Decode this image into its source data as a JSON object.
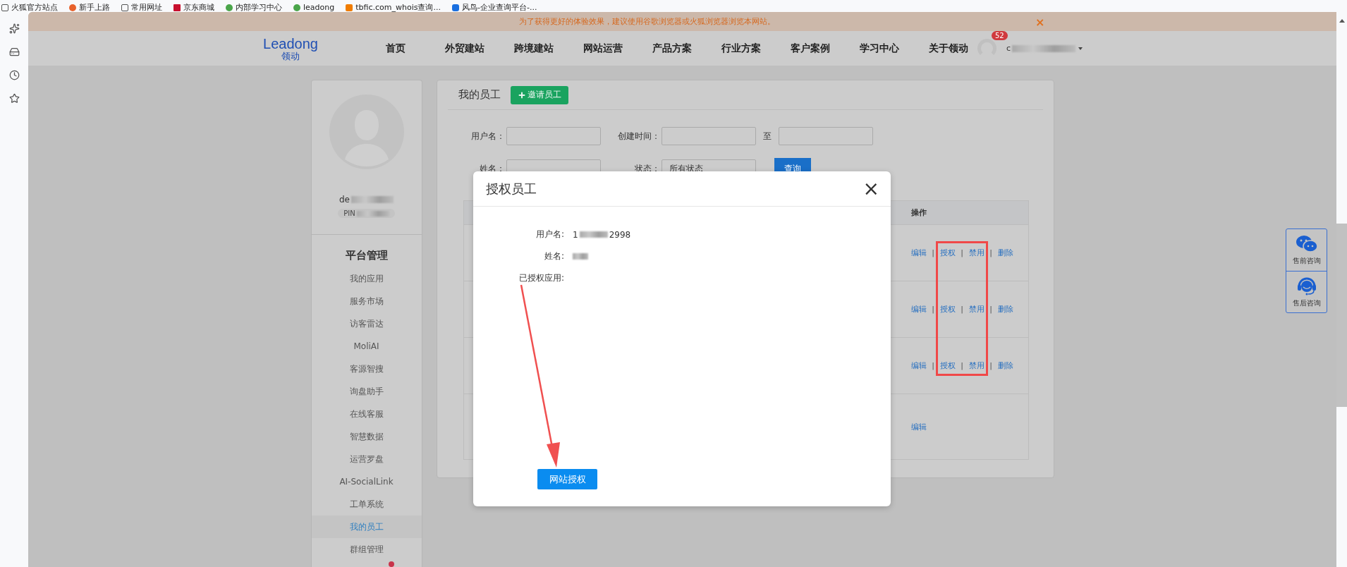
{
  "bookmarks": [
    {
      "label": "火狐官方站点"
    },
    {
      "label": "新手上路"
    },
    {
      "label": "常用网址"
    },
    {
      "label": "京东商城"
    },
    {
      "label": "内部学习中心"
    },
    {
      "label": "leadong"
    },
    {
      "label": "tbfic.com_whois查询..."
    },
    {
      "label": "风鸟-企业查询平台-..."
    }
  ],
  "notice": {
    "text": "为了获得更好的体验效果，建议使用谷歌浏览器或火狐浏览器浏览本网站。",
    "close": "×"
  },
  "nav": {
    "logo": {
      "name": "Leadong",
      "subtitle": "领动"
    },
    "items": [
      {
        "label": "首页"
      },
      {
        "label": "外贸建站"
      },
      {
        "label": "跨境建站"
      },
      {
        "label": "网站运营"
      },
      {
        "label": "产品方案"
      },
      {
        "label": "行业方案"
      },
      {
        "label": "客户案例"
      },
      {
        "label": "学习中心"
      },
      {
        "label": "关于领动"
      }
    ],
    "user": {
      "badge": "52",
      "name": "c"
    }
  },
  "profile": {
    "name": "de",
    "tag": "PIN"
  },
  "sidebar": {
    "title": "平台管理",
    "items": [
      {
        "label": "我的应用",
        "selected": false
      },
      {
        "label": "服务市场",
        "selected": false
      },
      {
        "label": "访客雷达",
        "selected": false
      },
      {
        "label": "MoliAI",
        "selected": false
      },
      {
        "label": "客源智搜",
        "selected": false
      },
      {
        "label": "询盘助手",
        "selected": false
      },
      {
        "label": "在线客服",
        "selected": false
      },
      {
        "label": "智慧数据",
        "selected": false
      },
      {
        "label": "运营罗盘",
        "selected": false
      },
      {
        "label": "AI-SocialLink",
        "selected": false
      },
      {
        "label": "工单系统",
        "selected": false
      },
      {
        "label": "我的员工",
        "selected": true
      },
      {
        "label": "群组管理",
        "selected": false
      }
    ]
  },
  "panel": {
    "title": "我的员工",
    "invite_button": "邀请员工",
    "filters": {
      "username": "用户名：",
      "created": "创建时间：",
      "to": "至",
      "name": "姓名：",
      "status": "状态：",
      "status_value": "所有状态",
      "search_button": "查询"
    },
    "table": {
      "columns": [
        "操作"
      ],
      "separator": "|",
      "rows": [
        {
          "actions": [
            "编辑",
            "授权",
            "禁用",
            "删除"
          ]
        },
        {
          "actions": [
            "编辑",
            "授权",
            "禁用",
            "删除"
          ]
        },
        {
          "actions": [
            "编辑",
            "授权",
            "禁用",
            "删除"
          ]
        },
        {
          "actions": [
            "编辑"
          ]
        }
      ]
    }
  },
  "modal": {
    "title": "授权员工",
    "close": "×",
    "fields": [
      {
        "label": "用户名:",
        "value_start": "1",
        "value_end": "2998"
      },
      {
        "label": "姓名:"
      },
      {
        "label": "已授权应用:"
      }
    ],
    "button": "网站授权"
  },
  "support": [
    {
      "label": "售前咨询"
    },
    {
      "label": "售后咨询"
    }
  ]
}
